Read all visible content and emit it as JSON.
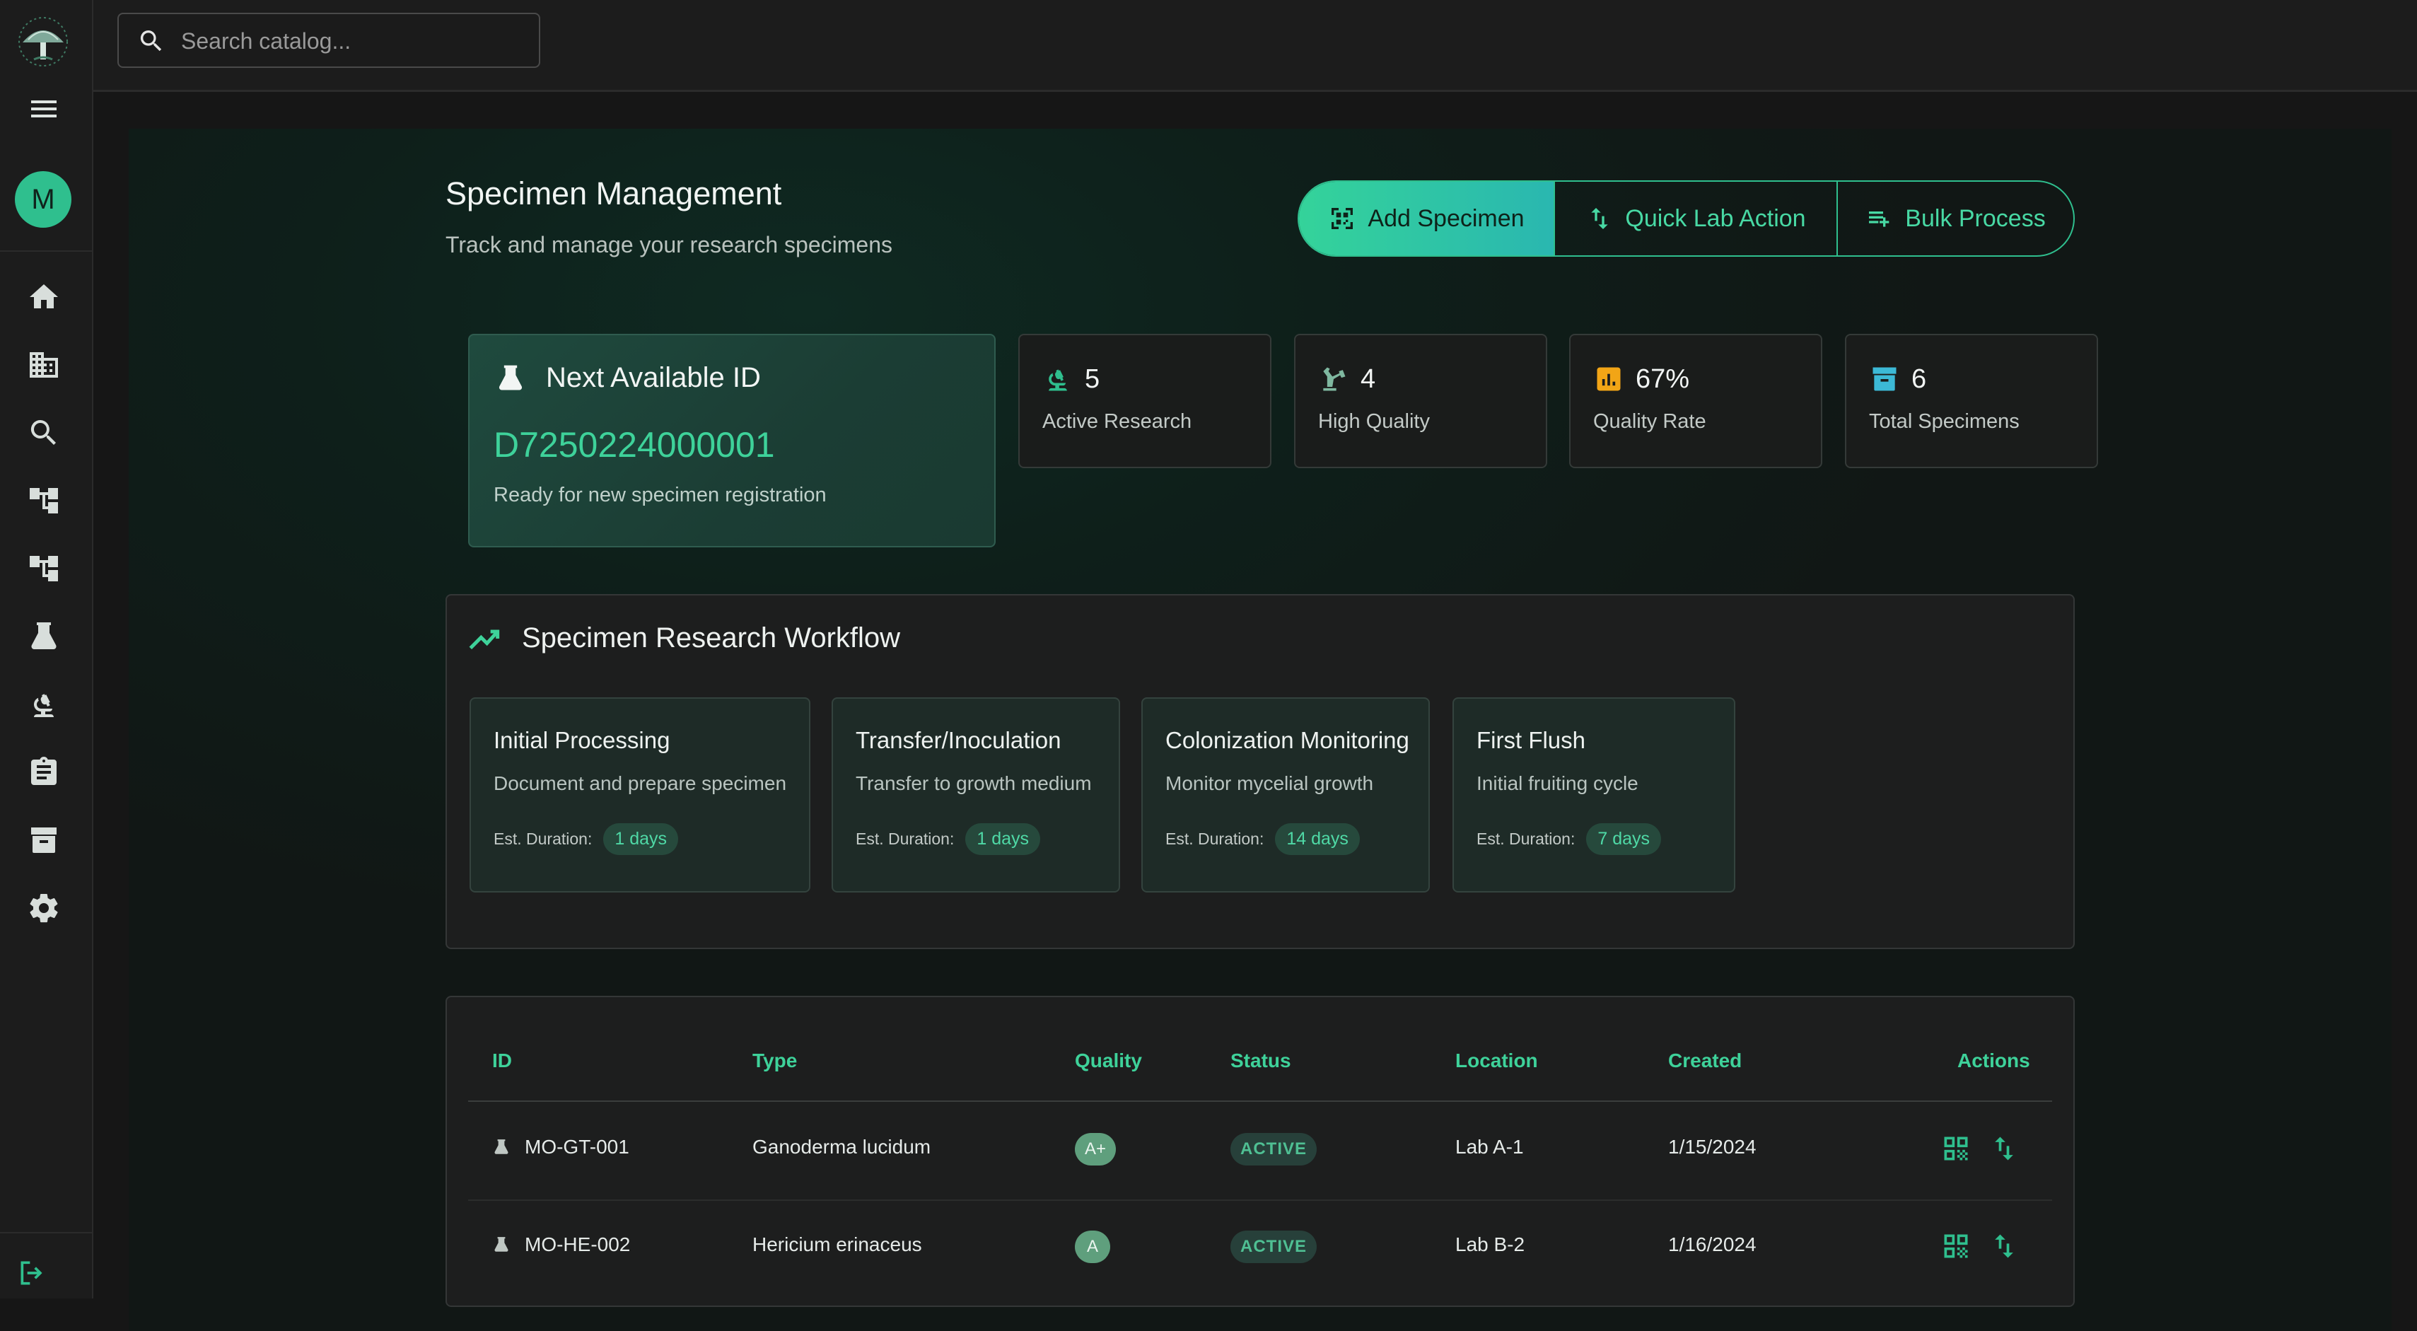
{
  "search": {
    "placeholder": "Search catalog..."
  },
  "user": {
    "initial": "M"
  },
  "colors": {
    "accent": "#2fbf8e",
    "accent_text": "#3ed29a",
    "background": "#161616",
    "panel": "#1d1e1e"
  },
  "sidebar": {
    "items": [
      {
        "icon": "home-icon"
      },
      {
        "icon": "building-icon"
      },
      {
        "icon": "search-icon"
      },
      {
        "icon": "tree-icon"
      },
      {
        "icon": "tree-icon"
      },
      {
        "icon": "flask-icon"
      },
      {
        "icon": "microscope-icon"
      },
      {
        "icon": "clipboard-icon"
      },
      {
        "icon": "archive-icon"
      },
      {
        "icon": "gear-icon"
      }
    ]
  },
  "header": {
    "title": "Specimen Management",
    "subtitle": "Track and manage your research specimens",
    "actions": {
      "add": "Add Specimen",
      "quick": "Quick Lab Action",
      "bulk": "Bulk Process"
    }
  },
  "next_id": {
    "title": "Next Available ID",
    "value": "D7250224000001",
    "note": "Ready for new specimen registration"
  },
  "stats": [
    {
      "value": "5",
      "label": "Active Research",
      "icon": "microscope-icon"
    },
    {
      "value": "4",
      "label": "High Quality",
      "icon": "robot-arm-icon"
    },
    {
      "value": "67%",
      "label": "Quality Rate",
      "icon": "bar-chart-icon"
    },
    {
      "value": "6",
      "label": "Total Specimens",
      "icon": "archive-icon"
    }
  ],
  "workflow": {
    "title": "Specimen Research Workflow",
    "duration_label": "Est. Duration:",
    "steps": [
      {
        "title": "Initial Processing",
        "desc": "Document and prepare specimen",
        "duration": "1 days"
      },
      {
        "title": "Transfer/Inoculation",
        "desc": "Transfer to growth medium",
        "duration": "1 days"
      },
      {
        "title": "Colonization Monitoring",
        "desc": "Monitor mycelial growth",
        "duration": "14 days"
      },
      {
        "title": "First Flush",
        "desc": "Initial fruiting cycle",
        "duration": "7 days"
      }
    ]
  },
  "table": {
    "columns": [
      "ID",
      "Type",
      "Quality",
      "Status",
      "Location",
      "Created",
      "Actions"
    ],
    "rows": [
      {
        "id": "MO-GT-001",
        "type": "Ganoderma lucidum",
        "quality": "A+",
        "status": "ACTIVE",
        "location": "Lab A-1",
        "created": "1/15/2024"
      },
      {
        "id": "MO-HE-002",
        "type": "Hericium erinaceus",
        "quality": "A",
        "status": "ACTIVE",
        "location": "Lab B-2",
        "created": "1/16/2024"
      }
    ]
  }
}
